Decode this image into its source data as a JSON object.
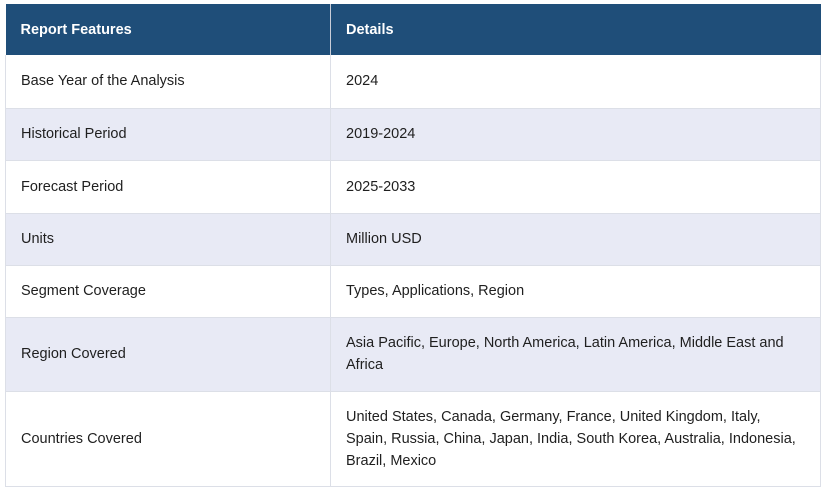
{
  "table": {
    "headers": [
      "Report Features",
      "Details"
    ],
    "rows": [
      {
        "feature": "Base Year of the Analysis",
        "details": "2024"
      },
      {
        "feature": "Historical Period",
        "details": "2019-2024"
      },
      {
        "feature": "Forecast Period",
        "details": "2025-2033"
      },
      {
        "feature": "Units",
        "details": "Million USD"
      },
      {
        "feature": "Segment Coverage",
        "details": "Types, Applications, Region"
      },
      {
        "feature": "Region Covered",
        "details": "Asia Pacific, Europe, North America, Latin America, Middle East and Africa"
      },
      {
        "feature": "Countries Covered",
        "details": "United States, Canada, Germany, France, United Kingdom, Italy, Spain, Russia, China, Japan, India, South Korea, Australia, Indonesia, Brazil, Mexico"
      }
    ]
  },
  "colors": {
    "header_bg": "#1f4e79",
    "header_text": "#ffffff",
    "stripe_bg": "#e8eaf5",
    "row_bg": "#ffffff"
  }
}
